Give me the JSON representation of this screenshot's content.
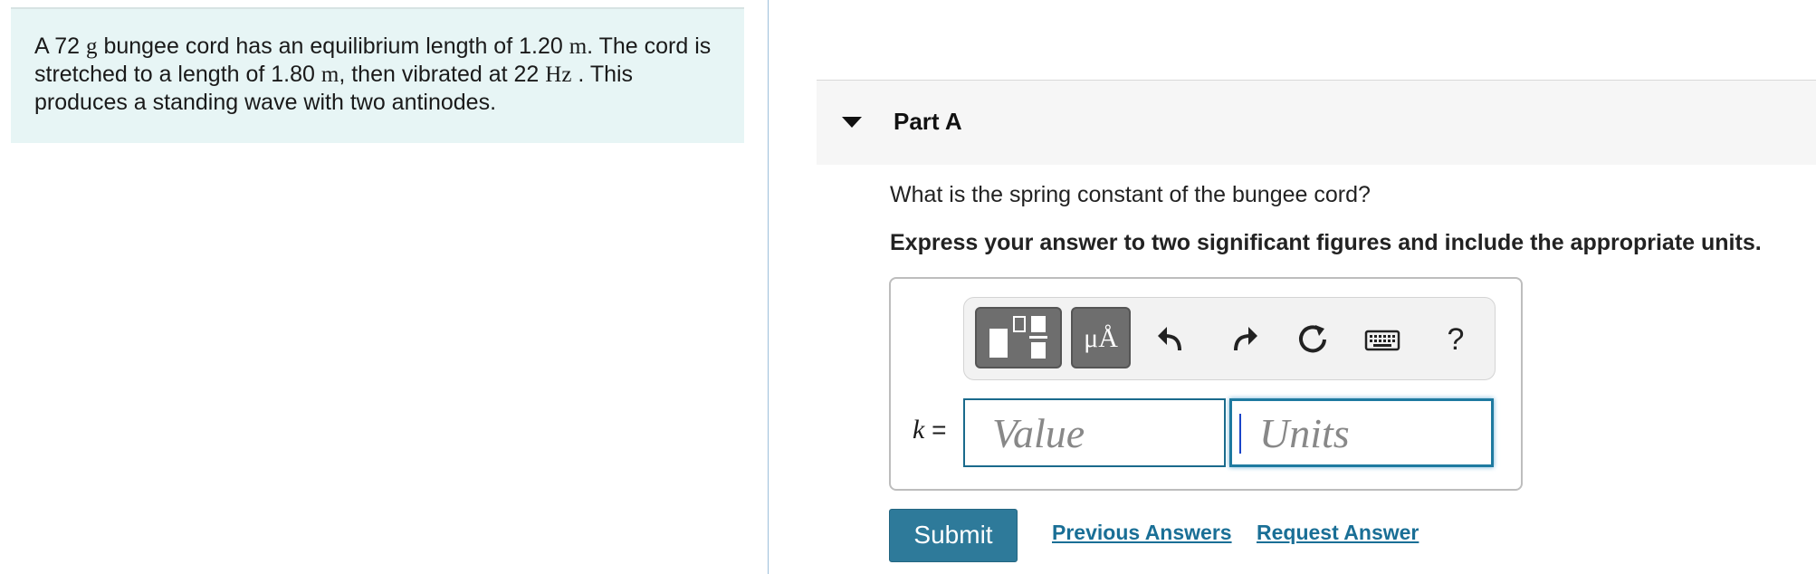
{
  "problem": {
    "text_1": "A 72 ",
    "unit_g": "g",
    "text_2": " bungee cord has an equilibrium length of 1.20 ",
    "unit_m1": "m",
    "text_3": ". The cord is stretched to a length of 1.80 ",
    "unit_m2": "m",
    "text_4": ", then vibrated at 22 ",
    "unit_hz": "Hz",
    "text_5": " . This produces a standing wave with two antinodes."
  },
  "part": {
    "title": "Part A",
    "question": "What is the spring constant of the bungee cord?",
    "instruction": "Express your answer to two significant figures and include the appropriate units."
  },
  "toolbar": {
    "symbol_label": "μÅ",
    "help_label": "?"
  },
  "answer": {
    "variable": "k",
    "equals": " =",
    "value_placeholder": "Value",
    "units_placeholder": "Units"
  },
  "actions": {
    "submit_label": "Submit",
    "previous_answers_label": "Previous Answers",
    "request_answer_label": "Request Answer"
  },
  "colors": {
    "problem_bg": "#e7f5f5",
    "submit_bg": "#2e7a9a",
    "link": "#1a6f96"
  }
}
